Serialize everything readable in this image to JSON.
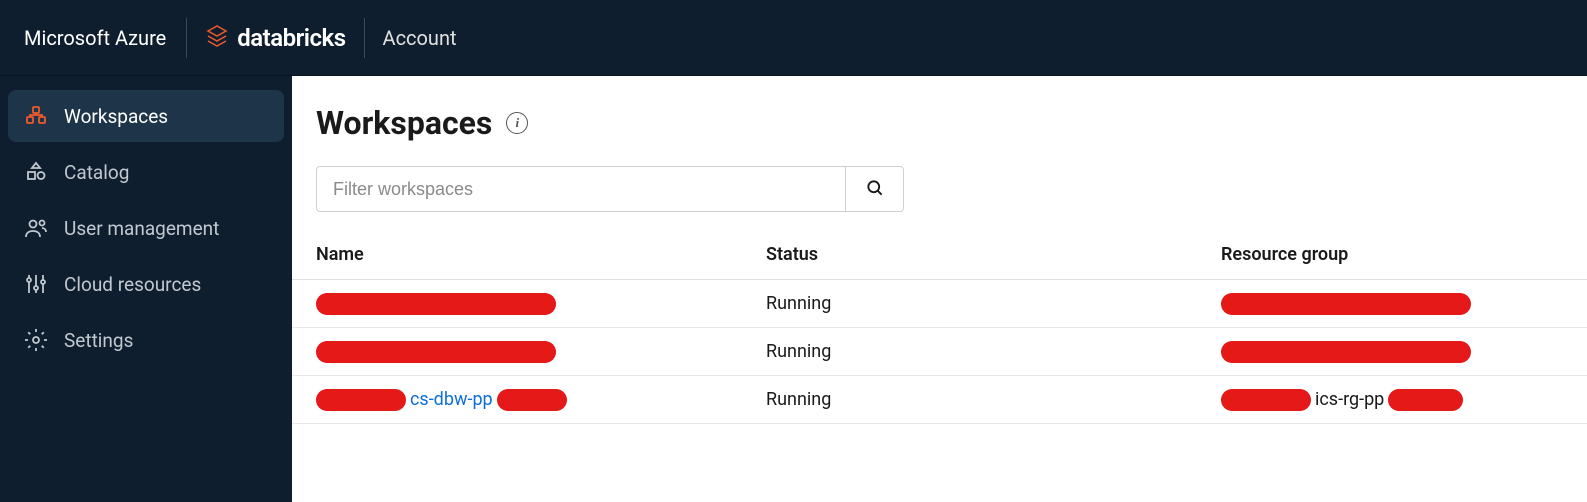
{
  "header": {
    "brand": "Microsoft Azure",
    "product": "databricks",
    "context": "Account"
  },
  "sidebar": {
    "items": [
      {
        "label": "Workspaces",
        "active": true
      },
      {
        "label": "Catalog",
        "active": false
      },
      {
        "label": "User management",
        "active": false
      },
      {
        "label": "Cloud resources",
        "active": false
      },
      {
        "label": "Settings",
        "active": false
      }
    ]
  },
  "page": {
    "title": "Workspaces"
  },
  "filter": {
    "placeholder": "Filter workspaces"
  },
  "table": {
    "columns": {
      "name": "Name",
      "status": "Status",
      "resource_group": "Resource group"
    },
    "rows": [
      {
        "name_visible": "",
        "status": "Running",
        "rg_visible": ""
      },
      {
        "name_visible": "",
        "status": "Running",
        "rg_visible": ""
      },
      {
        "name_visible": "cs-dbw-pp",
        "status": "Running",
        "rg_visible": "ics-rg-pp"
      }
    ]
  }
}
